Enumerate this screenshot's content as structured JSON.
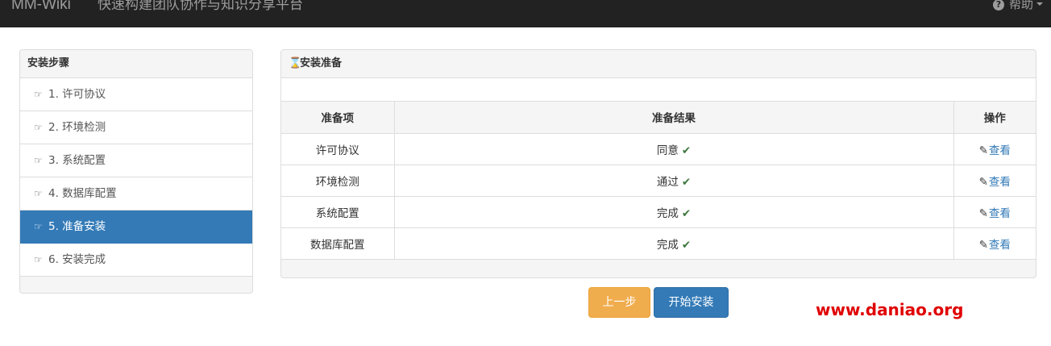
{
  "navbar": {
    "brand": "MM-Wiki",
    "tagline": "快速构建团队协作与知识分享平台",
    "help_label": "帮助",
    "help_icon": "question-circle-icon"
  },
  "sidebar": {
    "title": "安装步骤",
    "items": [
      {
        "label": "1. 许可协议"
      },
      {
        "label": "2. 环境检测"
      },
      {
        "label": "3. 系统配置"
      },
      {
        "label": "4. 数据库配置"
      },
      {
        "label": "5. 准备安装"
      },
      {
        "label": "6. 安装完成"
      }
    ],
    "active_index": 4,
    "active_color": "#337ab7"
  },
  "main": {
    "title": "安装准备",
    "table": {
      "headers": [
        "准备项",
        "准备结果",
        "操作"
      ],
      "rows": [
        {
          "item": "许可协议",
          "result": "同意",
          "action": "查看"
        },
        {
          "item": "环境检测",
          "result": "通过",
          "action": "查看"
        },
        {
          "item": "系统配置",
          "result": "完成",
          "action": "查看"
        },
        {
          "item": "数据库配置",
          "result": "完成",
          "action": "查看"
        }
      ]
    }
  },
  "actions": {
    "prev_label": "上一步",
    "start_label": "开始安装",
    "prev_color": "#f0ad4e",
    "start_color": "#337ab7"
  },
  "watermark": "www.daniao.org"
}
